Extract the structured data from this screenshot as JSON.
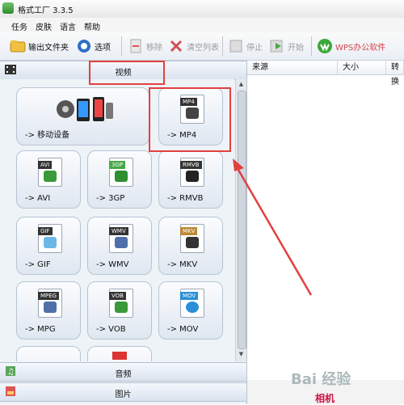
{
  "window": {
    "title": "格式工厂 3.3.5"
  },
  "menu": [
    "任务",
    "皮肤",
    "语言",
    "帮助"
  ],
  "toolbar": {
    "output_folder": "输出文件夹",
    "options": "选项",
    "remove": "移除",
    "clear_list": "清空列表",
    "stop": "停止",
    "start": "开始",
    "wps": "WPS办公软件"
  },
  "categories": {
    "video": "视频",
    "audio": "音频",
    "image": "图片"
  },
  "formats": {
    "mobile": "-> 移动设备",
    "mp4": "-> MP4",
    "avi": "-> AVI",
    "3gp": "-> 3GP",
    "rmvb": "-> RMVB",
    "gif": "-> GIF",
    "wmv": "-> WMV",
    "mkv": "-> MKV",
    "mpg": "-> MPG",
    "vob": "-> VOB",
    "mov": "-> MOV"
  },
  "file_tags": {
    "mp4": "MP4",
    "avi": "AVI",
    "3gp": "3GP",
    "rmvb": "RMVB",
    "gif": "GIF",
    "wmv": "WMV",
    "mkv": "MKV",
    "mpg": "MPEG",
    "vob": "VOB",
    "mov": "MOV"
  },
  "task_list": {
    "columns": [
      "来源",
      "大小",
      "转换"
    ]
  },
  "banner": {
    "watermark": "Bai 经验",
    "promo": "相机"
  },
  "colors": {
    "annotation": "#e24040",
    "accent": "#2e8d2e"
  }
}
